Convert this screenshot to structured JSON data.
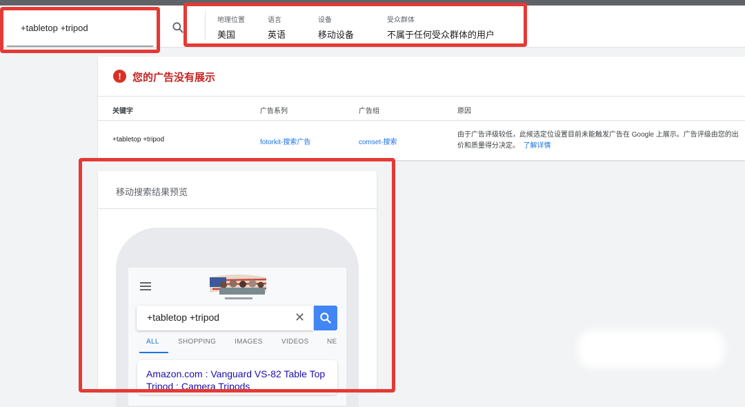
{
  "header": {
    "keyword_value": "+tabletop +tripod",
    "filters": [
      {
        "label": "地理位置",
        "value": "美国"
      },
      {
        "label": "语言",
        "value": "英语"
      },
      {
        "label": "设备",
        "value": "移动设备"
      },
      {
        "label": "受众群体",
        "value": "不属于任何受众群体的用户"
      }
    ]
  },
  "alert": {
    "message": "您的广告没有展示"
  },
  "table": {
    "headers": [
      "关键字",
      "广告系列",
      "广告组",
      "原因"
    ],
    "row": {
      "keyword": "+tabletop +tripod",
      "campaign": "fotorkit-搜索广告",
      "ad_group": "comset-搜索",
      "reason_line1": "由于广告评级较低，此候选定位设置目前未能触发广告在 Google 上展示。广告评级由您的出",
      "reason_line2": "价和质量得分决定。",
      "learn_more": "了解详情"
    }
  },
  "preview": {
    "title": "移动搜索结果预览",
    "search_query": "+tabletop +tripod",
    "tabs": [
      "ALL",
      "SHOPPING",
      "IMAGES",
      "VIDEOS",
      "NE"
    ],
    "active_tab": "ALL",
    "result_title": "Amazon.com : Vanguard VS-82 Table Top Tripod : Camera Tripods"
  },
  "colors": {
    "highlight": "#e53935",
    "error": "#d93025",
    "link": "#1a73e8",
    "google_blue": "#4285f4"
  },
  "icons": [
    "search-icon",
    "error-icon",
    "menu-icon",
    "close-icon",
    "doodle-logo"
  ]
}
